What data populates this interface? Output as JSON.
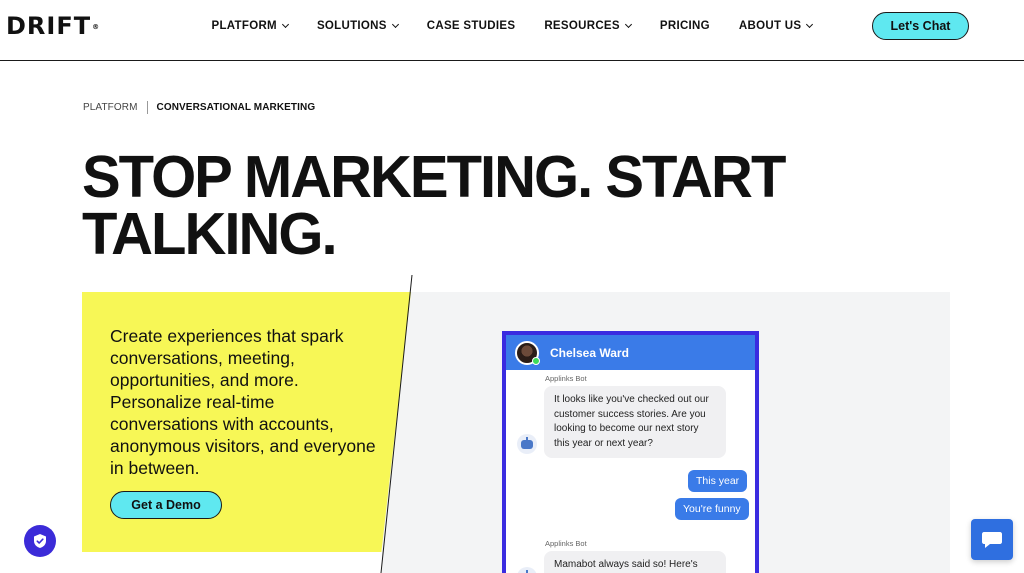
{
  "header": {
    "logo": "DRIFT",
    "logo_mark": "®",
    "nav": [
      {
        "label": "PLATFORM",
        "dropdown": true
      },
      {
        "label": "SOLUTIONS",
        "dropdown": true
      },
      {
        "label": "CASE STUDIES",
        "dropdown": false
      },
      {
        "label": "RESOURCES",
        "dropdown": true
      },
      {
        "label": "PRICING",
        "dropdown": false
      },
      {
        "label": "ABOUT US",
        "dropdown": true
      }
    ],
    "cta": "Let's Chat"
  },
  "breadcrumb": {
    "parent": "PLATFORM",
    "current": "CONVERSATIONAL MARKETING"
  },
  "hero": {
    "title_line1": "STOP MARKETING. START",
    "title_line2": "TALKING.",
    "body": "Create experiences that spark conversations, meeting, opportunities, and more. Personalize real-time conversations with accounts, anonymous visitors, and everyone in between.",
    "cta": "Get a Demo"
  },
  "chat_preview": {
    "agent_name": "Chelsea Ward",
    "bot_label": "Applinks Bot",
    "message_1": "It looks like you've checked out our customer success stories. Are you looking to become our next story this year or next year?",
    "reply_1": "This year",
    "reply_2": "You're funny",
    "bot_label_2": "Applinks Bot",
    "message_2": "Mamabot always said so! Here's"
  },
  "colors": {
    "accent_cyan": "#5fe8f0",
    "highlight_yellow": "#f7f756",
    "chat_blue": "#3a7be8",
    "frame_purple": "#3a2be0"
  },
  "icons": {
    "privacy": "shield-check-icon",
    "chat_launcher": "chat-bubble-icon",
    "bot": "robot-icon"
  }
}
